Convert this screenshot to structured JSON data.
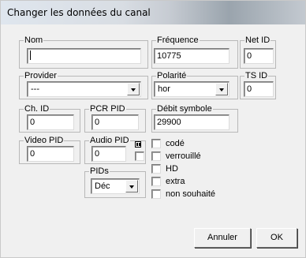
{
  "window": {
    "title": "Changer les données du canal"
  },
  "fields": {
    "nom": {
      "label": "Nom",
      "value": ""
    },
    "frequence": {
      "label": "Fréquence",
      "value": "10775"
    },
    "net_id": {
      "label": "Net ID",
      "value": "0"
    },
    "provider": {
      "label": "Provider",
      "value": "---"
    },
    "polarite": {
      "label": "Polarité",
      "value": "hor"
    },
    "ts_id": {
      "label": "TS ID",
      "value": "0"
    },
    "ch_id": {
      "label": "Ch. ID",
      "value": "0"
    },
    "pcr_pid": {
      "label": "PCR PID",
      "value": "0"
    },
    "debit_symbole": {
      "label": "Débit symbole",
      "value": "29900"
    },
    "video_pid": {
      "label": "Video PID",
      "value": "0"
    },
    "audio_pid": {
      "label": "Audio PID",
      "value": "0"
    },
    "pids": {
      "label": "PIDs",
      "value": "Déc"
    }
  },
  "checkboxes": [
    {
      "label": "codé",
      "checked": false
    },
    {
      "label": "verrouillé",
      "checked": false
    },
    {
      "label": "HD",
      "checked": false
    },
    {
      "label": "extra",
      "checked": false
    },
    {
      "label": "non souhaité",
      "checked": false
    }
  ],
  "buttons": {
    "cancel": "Annuler",
    "ok": "OK"
  },
  "icons": {
    "audio_channel": "stereo-icon"
  }
}
